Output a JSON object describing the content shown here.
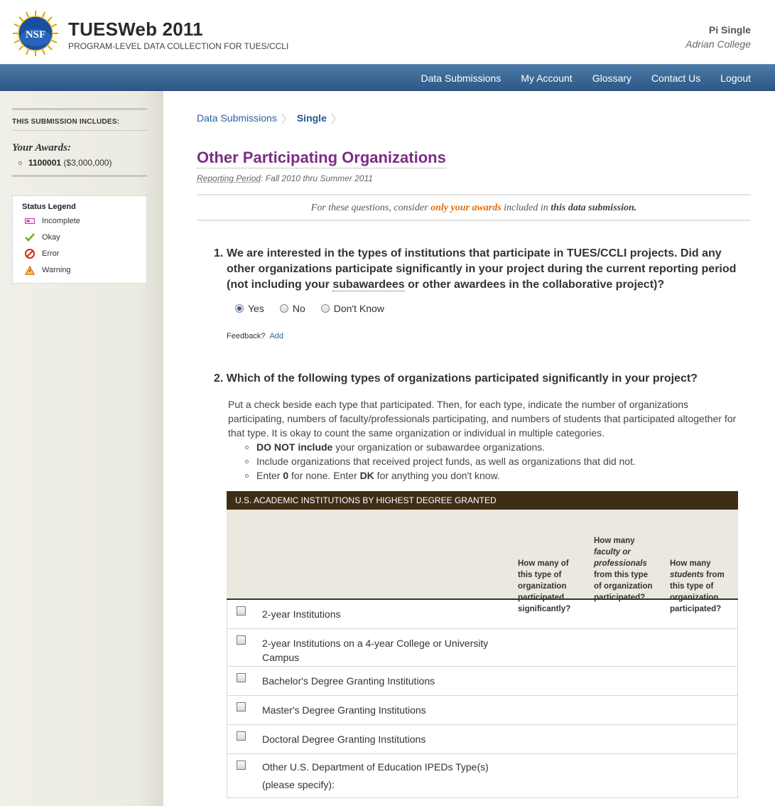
{
  "header": {
    "logo_text": "NSF",
    "title": "TUESWeb 2011",
    "subtitle": "PROGRAM-LEVEL DATA COLLECTION FOR TUES/CCLI",
    "user_name": "Pi Single",
    "user_org": "Adrian College"
  },
  "nav": {
    "items": [
      "Data Submissions",
      "My Account",
      "Glossary",
      "Contact Us",
      "Logout"
    ]
  },
  "sidebar": {
    "heading": "THIS SUBMISSION INCLUDES:",
    "awards_label": "Your Awards:",
    "award_id": "1100001",
    "award_amount": "($3,000,000)",
    "legend_title": "Status Legend",
    "legend": [
      "Incomplete",
      "Okay",
      "Error",
      "Warning"
    ]
  },
  "breadcrumb": {
    "link": "Data Submissions",
    "current": "Single"
  },
  "page": {
    "title": "Other Participating Organizations",
    "period_label": "Reporting Period",
    "period_value": ": Fall 2010 thru Summer 2011",
    "consider_pre": "For these questions, consider ",
    "consider_hl": "only your awards",
    "consider_mid": " included in ",
    "consider_bold": "this data submission."
  },
  "q1": {
    "num": "1.",
    "text_a": "We are interested in the types of institutions that participate in TUES/CCLI projects. Did any other organizations participate significantly in your project during the current reporting period (not including your ",
    "text_link": "subawardees",
    "text_b": " or other awardees in the collaborative project)?",
    "options": [
      "Yes",
      "No",
      "Don't Know"
    ],
    "selected": "Yes",
    "feedback_label": "Feedback?",
    "feedback_add": "Add"
  },
  "q2": {
    "num": "2.",
    "text": "Which of the following types of organizations participated significantly in your project?",
    "desc": "Put a check beside each type that participated. Then, for each type, indicate the number of organizations participating, numbers of faculty/professionals participating, and numbers of students that participated altogether for that type. It is okay to count the same organization or individual in multiple categories.",
    "bullet1_bold": "DO NOT include",
    "bullet1_rest": " your organization or subawardee organizations.",
    "bullet2": "Include organizations that received project funds, as well as organizations that did not.",
    "bullet3_a": "Enter ",
    "bullet3_b": "0",
    "bullet3_c": " for none. Enter ",
    "bullet3_d": "DK",
    "bullet3_e": " for anything you don't know."
  },
  "table": {
    "heading": "U.S. ACADEMIC INSTITUTIONS BY HIGHEST DEGREE GRANTED",
    "col1": "How many of this type of organization participated significantly?",
    "col2_a": "How many ",
    "col2_i": "faculty or professionals",
    "col2_b": " from this type of organization participated?",
    "col3_a": "How many ",
    "col3_i": "students",
    "col3_b": " from this type of organization participated?",
    "rows": [
      "2-year Institutions",
      "2-year Institutions on a 4-year College or University Campus",
      "Bachelor's Degree Granting Institutions",
      "Master's Degree Granting Institutions",
      "Doctoral Degree Granting Institutions",
      "Other U.S. Department of Education IPEDs Type(s) (please specify):"
    ]
  },
  "colors": {
    "nav_blue": "#2c5987",
    "title_purple": "#7b2d84",
    "highlight_orange": "#e46c0a",
    "table_header_brown": "#3f2e15"
  }
}
